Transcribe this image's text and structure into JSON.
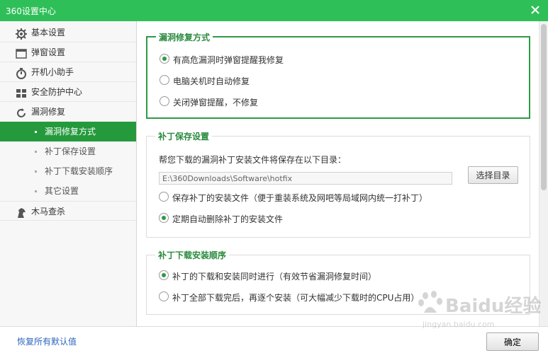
{
  "window": {
    "title": "360设置中心"
  },
  "sidebar": {
    "items": [
      {
        "label": "基本设置",
        "icon": "gear-icon"
      },
      {
        "label": "弹窗设置",
        "icon": "window-icon"
      },
      {
        "label": "开机小助手",
        "icon": "stopwatch-icon"
      },
      {
        "label": "安全防护中心",
        "icon": "grid-icon"
      },
      {
        "label": "漏洞修复",
        "icon": "refresh-icon"
      },
      {
        "label": "漏洞修复方式",
        "selected": true
      },
      {
        "label": "补丁保存设置"
      },
      {
        "label": "补丁下载安装顺序"
      },
      {
        "label": "其它设置"
      },
      {
        "label": "木马查杀",
        "icon": "horse-icon"
      }
    ]
  },
  "sections": {
    "repair_mode": {
      "title": "漏洞修复方式",
      "options": [
        {
          "label": "有高危漏洞时弹窗提醒我修复",
          "checked": true
        },
        {
          "label": "电脑关机时自动修复",
          "checked": false
        },
        {
          "label": "关闭弹窗提醒，不修复",
          "checked": false
        }
      ]
    },
    "patch_save": {
      "title": "补丁保存设置",
      "description": "帮您下载的漏洞补丁安装文件将保存在以下目录：",
      "path_value": "E:\\360Downloads\\Software\\hotfix",
      "browse_label": "选择目录",
      "options": [
        {
          "label": "保存补丁的安装文件（便于重装系统及网吧等局域网内统一打补丁）",
          "checked": false
        },
        {
          "label": "定期自动删除补丁的安装文件",
          "checked": true
        }
      ]
    },
    "download_order": {
      "title": "补丁下载安装顺序",
      "options": [
        {
          "label": "补丁的下载和安装同时进行（有效节省漏洞修复时间）",
          "checked": true
        },
        {
          "label": "补丁全部下载完后，再逐个安装（可大幅减少下载时的CPU占用）",
          "checked": false
        }
      ]
    }
  },
  "footer": {
    "reset_label": "恢复所有默认值",
    "ok_label": "确定"
  },
  "watermark": {
    "text": "Baidu经验",
    "sub": "jingyan.baidu.com"
  },
  "colors": {
    "title_bar": "#2fbf58",
    "accent": "#249a3d",
    "link": "#2a66c0"
  }
}
